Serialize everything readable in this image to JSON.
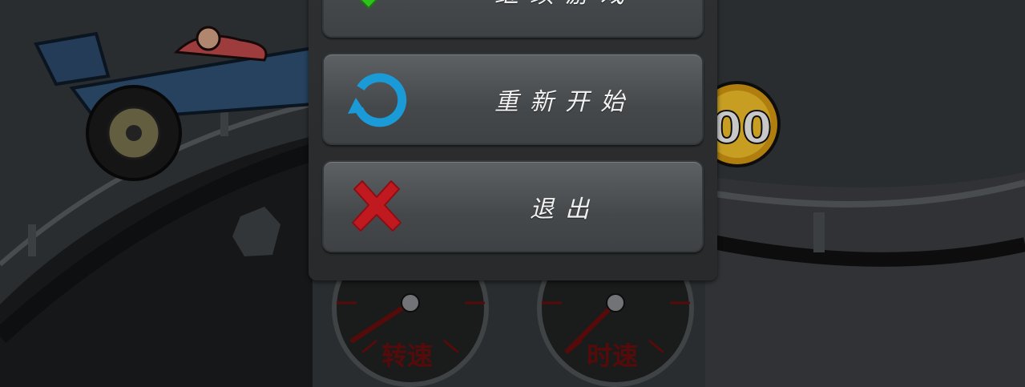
{
  "pause_menu": {
    "items": [
      {
        "label": "继续游戏",
        "icon": "green-checkmark-icon"
      },
      {
        "label": "重新开始",
        "icon": "restart-icon"
      },
      {
        "label": "退出",
        "icon": "red-x-icon"
      }
    ]
  },
  "hud": {
    "rpm_gauge_label": "转速",
    "speed_gauge_label": "时速",
    "coin_value": "00"
  },
  "colors": {
    "check_green": "#2fc21a",
    "restart_blue": "#1a9ad6",
    "exit_red": "#c0191f",
    "gauge_label_red": "#6a0e0e"
  }
}
